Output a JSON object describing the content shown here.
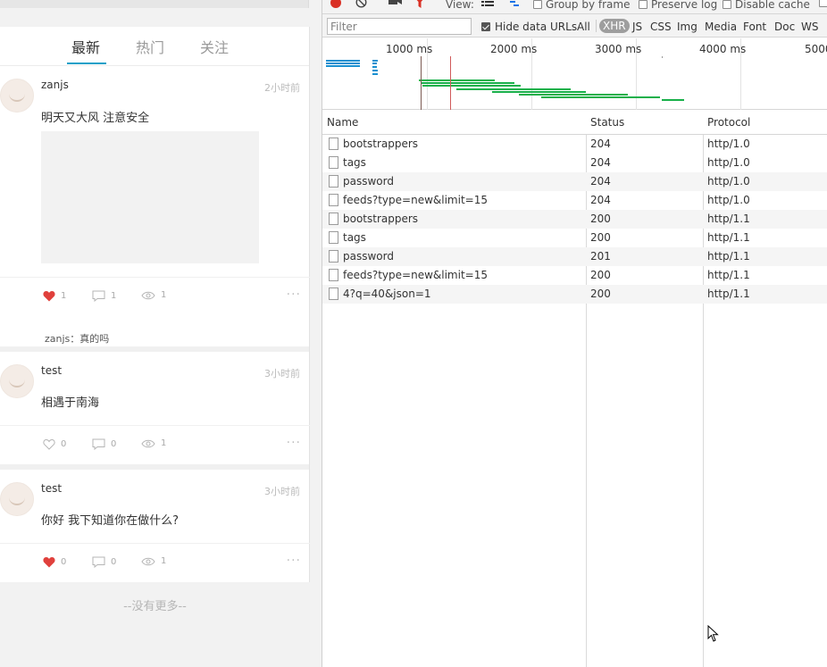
{
  "app": {
    "tabs": [
      {
        "label": "最新",
        "active": true
      },
      {
        "label": "热门",
        "active": false
      },
      {
        "label": "关注",
        "active": false
      }
    ],
    "posts": [
      {
        "username": "zanjs",
        "time": "2小时前",
        "content": "明天又大风 注意安全",
        "has_image": true,
        "liked": true,
        "likes": "1",
        "comments": "1",
        "views": "1",
        "comment_author": "zanjs",
        "comment_text": "真的吗"
      },
      {
        "username": "test",
        "time": "3小时前",
        "content": "相遇于南海",
        "has_image": false,
        "liked": false,
        "likes": "0",
        "comments": "0",
        "views": "1"
      },
      {
        "username": "test",
        "time": "3小时前",
        "content": "你好 我下知道你在做什么?",
        "has_image": false,
        "liked": true,
        "likes": "0",
        "comments": "0",
        "views": "1"
      }
    ],
    "no_more": "--没有更多--",
    "colors": {
      "accent": "#1aa0c8",
      "like": "#e0403c"
    }
  },
  "devtools": {
    "toolbar": {
      "view_label": "View:",
      "group_by_frame": "Group by frame",
      "preserve_log": "Preserve log",
      "disable_cache": "Disable cache"
    },
    "filter": {
      "placeholder": "Filter",
      "hide_data_urls": "Hide data URLs",
      "hide_data_urls_checked": true,
      "types": [
        "All",
        "XHR",
        "JS",
        "CSS",
        "Img",
        "Media",
        "Font",
        "Doc",
        "WS"
      ],
      "active_type": "XHR"
    },
    "timeline": {
      "labels": [
        "1000 ms",
        "2000 ms",
        "3000 ms",
        "4000 ms",
        "5000"
      ]
    },
    "columns": [
      "Name",
      "Status",
      "Protocol"
    ],
    "requests": [
      {
        "name": "bootstrappers",
        "status": "204",
        "protocol": "http/1.0"
      },
      {
        "name": "tags",
        "status": "204",
        "protocol": "http/1.0"
      },
      {
        "name": "password",
        "status": "204",
        "protocol": "http/1.0"
      },
      {
        "name": "feeds?type=new&limit=15",
        "status": "204",
        "protocol": "http/1.0"
      },
      {
        "name": "bootstrappers",
        "status": "200",
        "protocol": "http/1.1"
      },
      {
        "name": "tags",
        "status": "200",
        "protocol": "http/1.1"
      },
      {
        "name": "password",
        "status": "201",
        "protocol": "http/1.1"
      },
      {
        "name": "feeds?type=new&limit=15",
        "status": "200",
        "protocol": "http/1.1"
      },
      {
        "name": "4?q=40&json=1",
        "status": "200",
        "protocol": "http/1.1"
      }
    ]
  }
}
